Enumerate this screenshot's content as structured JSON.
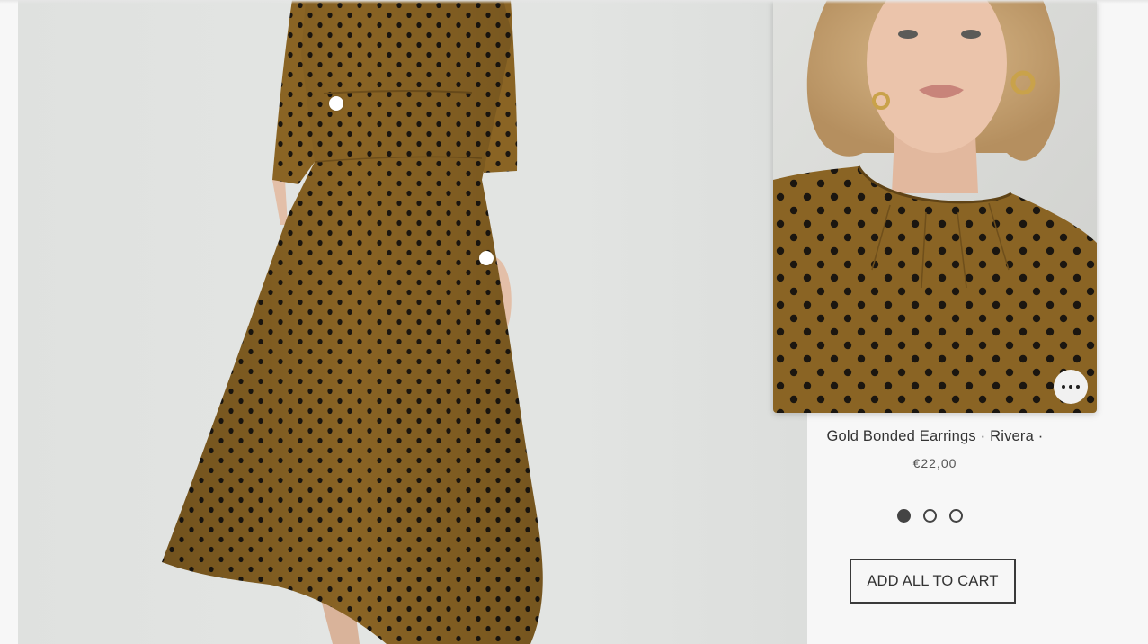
{
  "product": {
    "title": "Gold Bonded Earrings · Rivera ·",
    "price": "€22,00",
    "more_icon": "more-horizontal-icon"
  },
  "carousel": {
    "slides": 3,
    "active_index": 0
  },
  "actions": {
    "add_all_label": "ADD ALL TO CART"
  },
  "colors": {
    "dress": "#8a6424",
    "dots": "#1b1610",
    "background": "#f7f7f7",
    "button_border": "#3a3a3a"
  }
}
